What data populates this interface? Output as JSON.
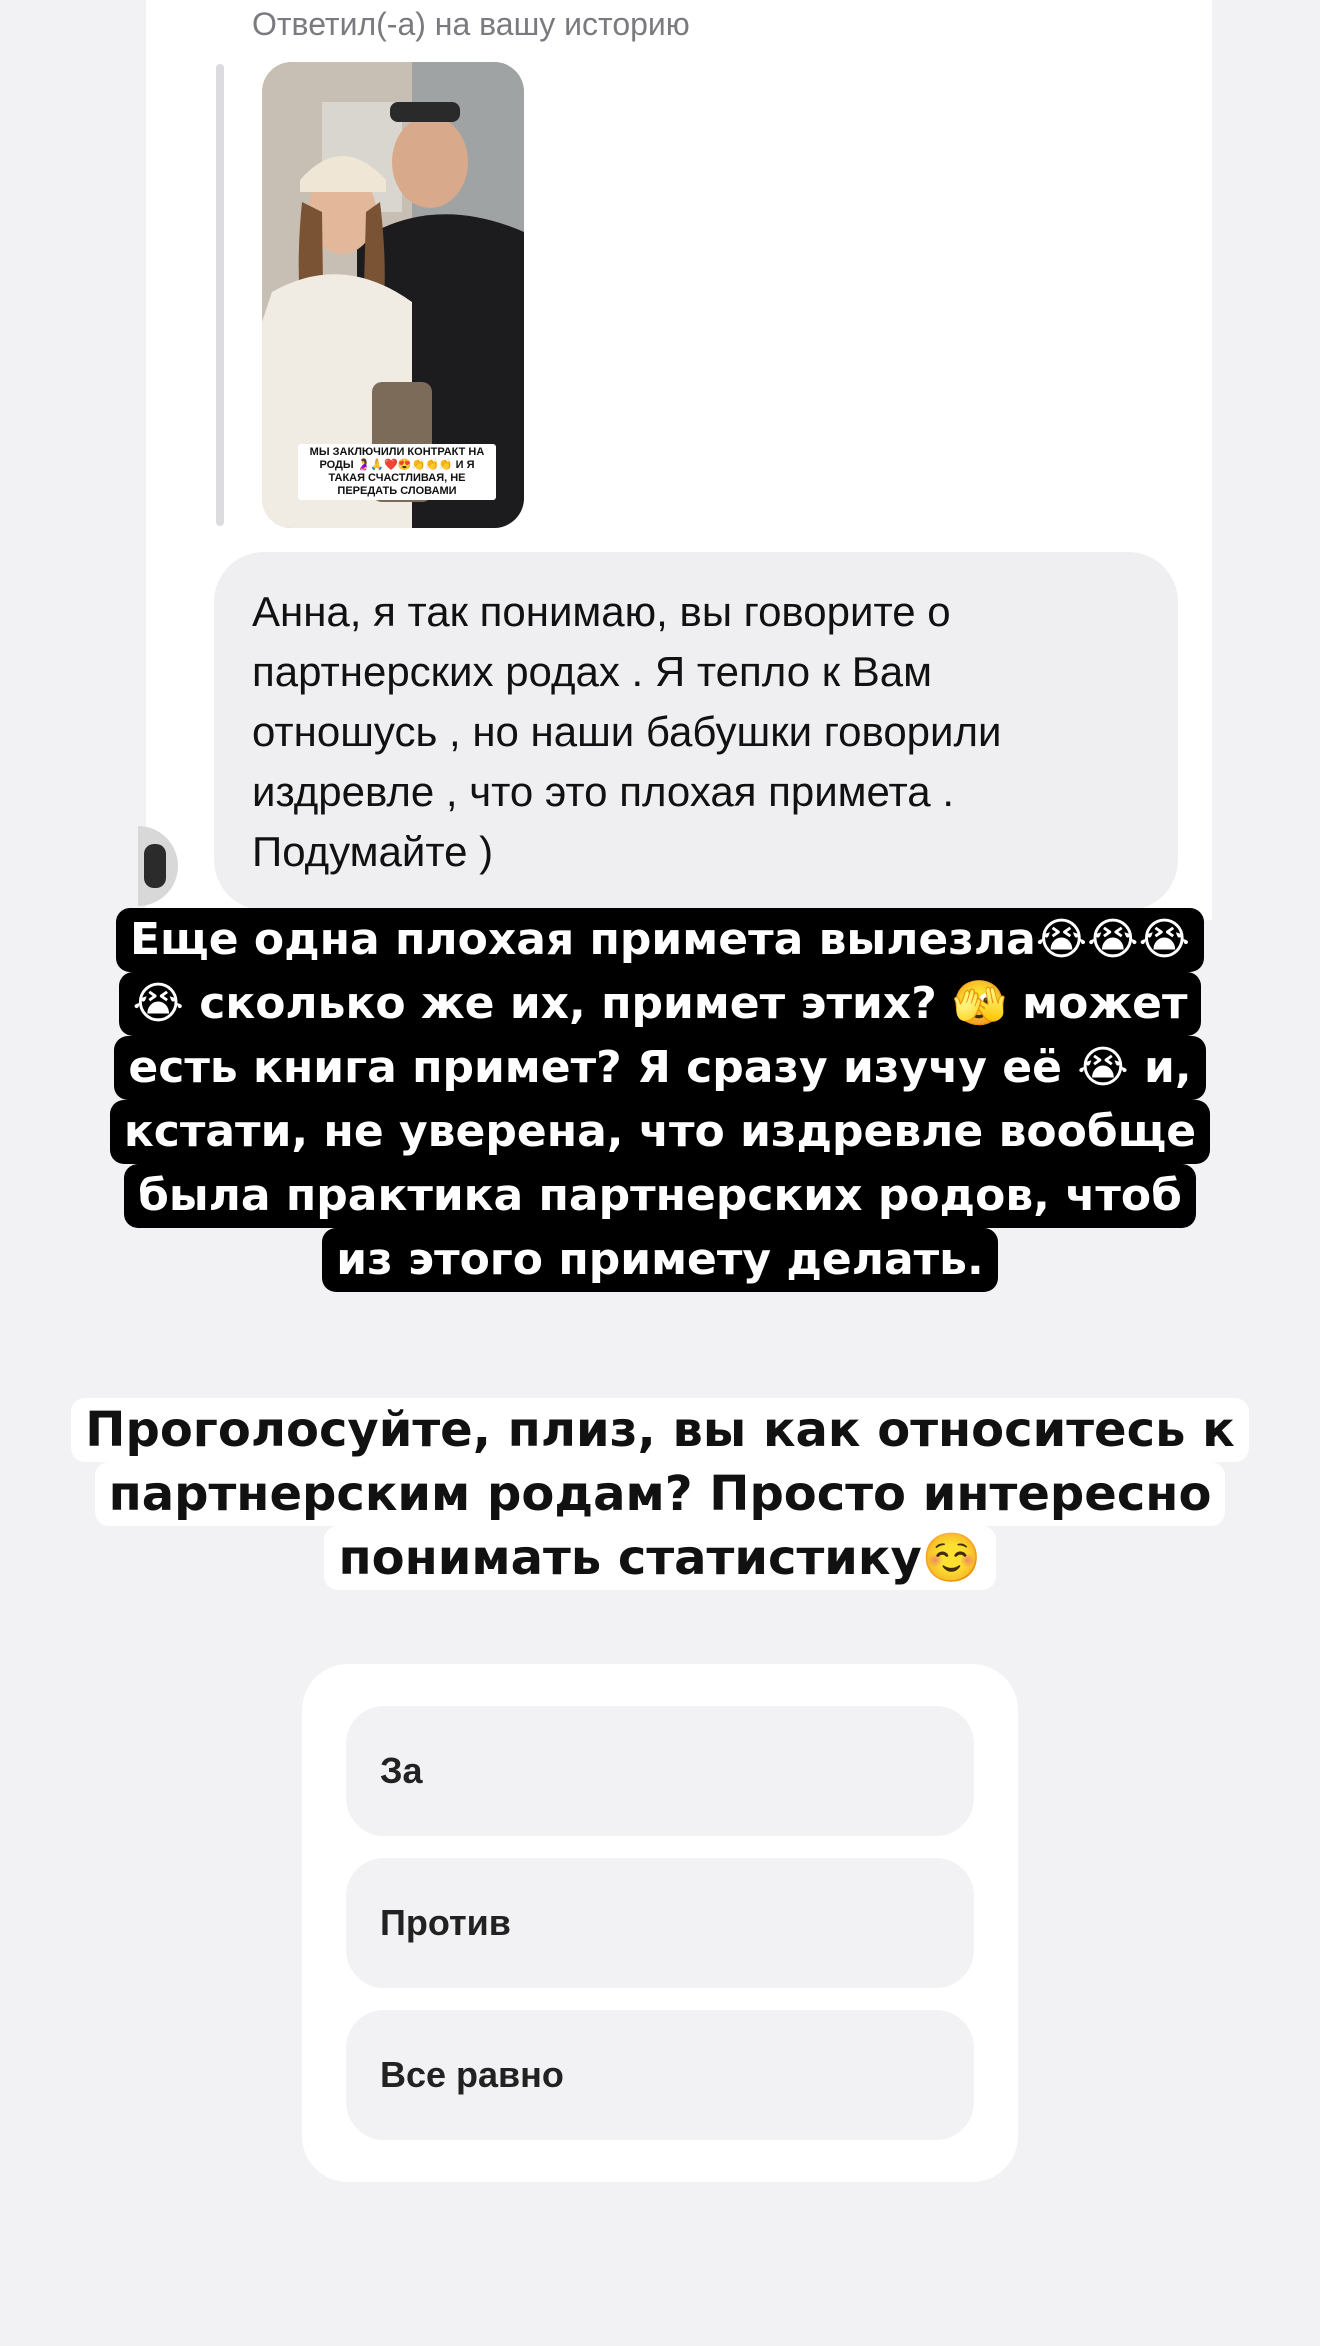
{
  "dm": {
    "replied_label": "Ответил(-а) на вашу историю",
    "story_caption": "МЫ ЗАКЛЮЧИЛИ КОНТРАКТ НА РОДЫ 🤰🙏❤️😍👏👏👏 И Я ТАКАЯ СЧАСТЛИВАЯ, НЕ ПЕРЕДАТЬ СЛОВАМИ",
    "message_lines": [
      "Анна, я так понимаю, вы говорите о",
      "партнерских родах . Я тепло к Вам",
      "отношусь , но наши бабушки говорили",
      "издревле , что это плохая примета .",
      "Подумайте )"
    ]
  },
  "story_text": {
    "lines": [
      "Еще одна плохая примета вылезла😭😭😭",
      "😭 сколько же их, примет этих? 🫣 может",
      "есть книга примет? Я сразу изучу её 😭 и,",
      "кстати, не уверена, что издревле вообще",
      "была практика партнерских родов, чтоб",
      "из этого примету делать."
    ]
  },
  "question": {
    "lines": [
      "Проголосуйте, плиз, вы как относитесь к",
      "партнерским родам? Просто интересно",
      "понимать статистику☺️"
    ]
  },
  "poll": {
    "options": [
      "За",
      "Против",
      "Все равно"
    ]
  }
}
